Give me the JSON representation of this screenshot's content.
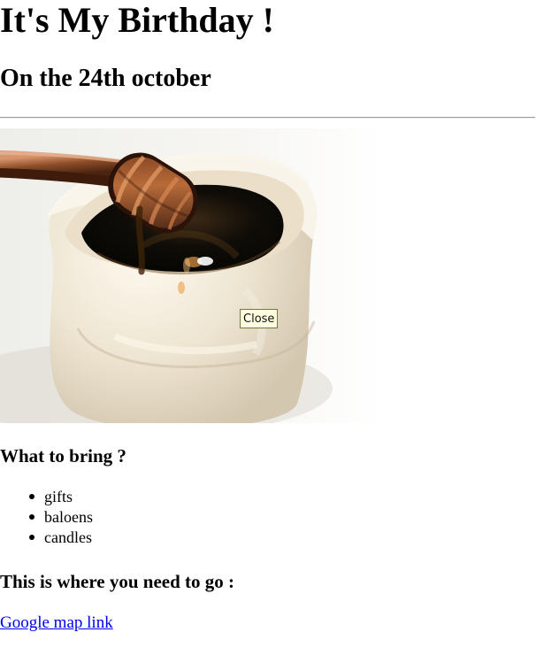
{
  "header": {
    "title": "It's My Birthday !",
    "subtitle": "On the 24th october"
  },
  "image": {
    "description_icon": "honey-jar-photo",
    "tooltip": "Close"
  },
  "bring_section": {
    "heading": "What to bring ?",
    "items": [
      {
        "label": "gifts"
      },
      {
        "label": "baloens"
      },
      {
        "label": "candles"
      }
    ]
  },
  "location_section": {
    "heading": "This is where you need to go :",
    "link_label": "Google map link"
  },
  "colors": {
    "link": "#0000ee",
    "tooltip_background": "#ffffe1",
    "horizontal_rule": "#9a9a9a"
  }
}
